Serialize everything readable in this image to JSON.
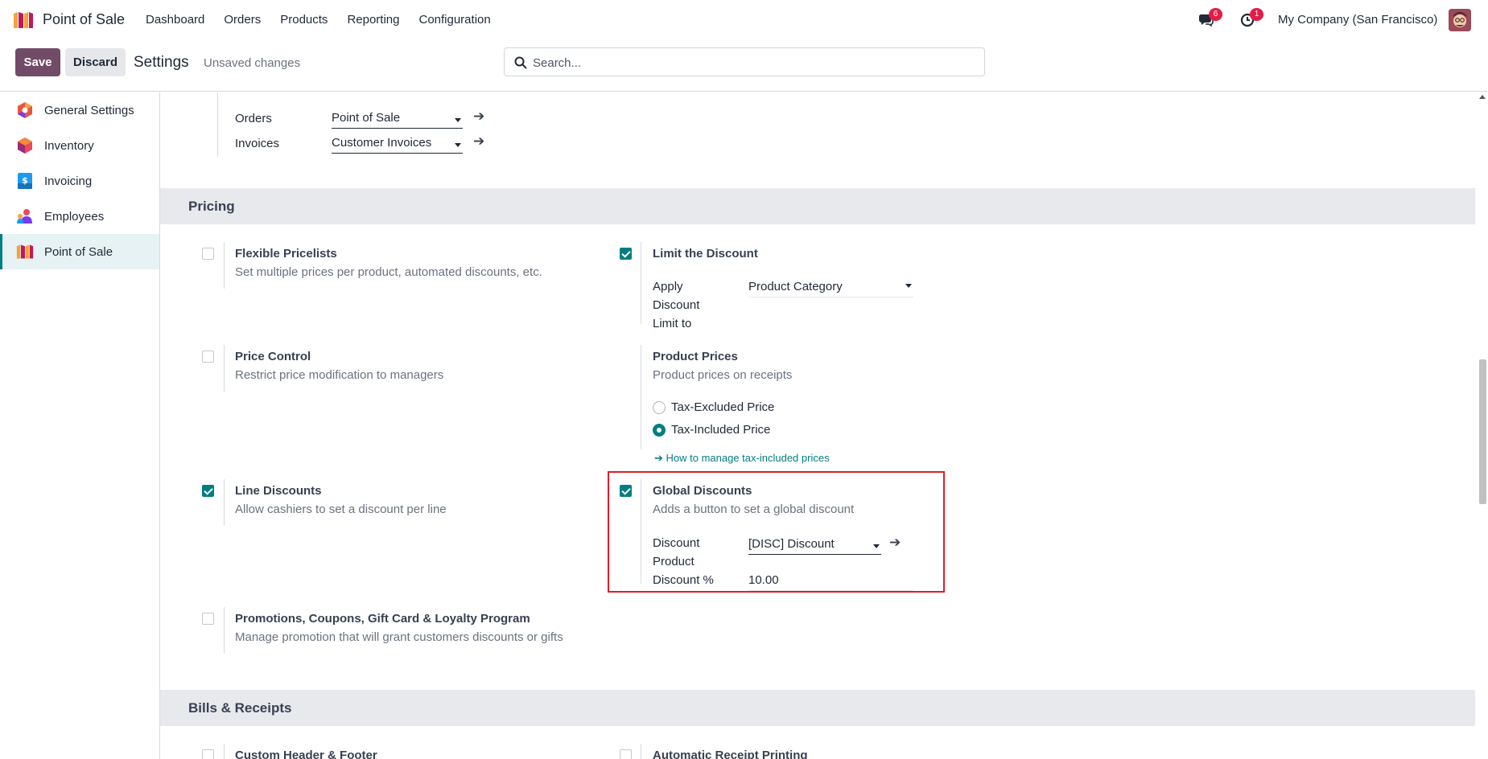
{
  "app": {
    "title": "Point of Sale"
  },
  "menu": [
    "Dashboard",
    "Orders",
    "Products",
    "Reporting",
    "Configuration"
  ],
  "topbar": {
    "messages_count": "6",
    "activities_count": "1",
    "company": "My Company (San Francisco)"
  },
  "control": {
    "save_label": "Save",
    "discard_label": "Discard",
    "breadcrumb": "Settings",
    "status": "Unsaved changes",
    "search_placeholder": "Search..."
  },
  "sidebar": {
    "items": [
      {
        "label": "General Settings",
        "icon": "general-settings-icon"
      },
      {
        "label": "Inventory",
        "icon": "inventory-icon"
      },
      {
        "label": "Invoicing",
        "icon": "invoicing-icon"
      },
      {
        "label": "Employees",
        "icon": "employees-icon"
      },
      {
        "label": "Point of Sale",
        "icon": "pos-icon",
        "active": true
      }
    ]
  },
  "journals": {
    "orders_label": "Orders",
    "orders_value": "Point of Sale",
    "invoices_label": "Invoices",
    "invoices_value": "Customer Invoices"
  },
  "pricing": {
    "section_title": "Pricing",
    "flexible_pricelists": {
      "title": "Flexible Pricelists",
      "desc": "Set multiple prices per product, automated discounts, etc.",
      "checked": false
    },
    "limit_discount": {
      "title": "Limit the Discount",
      "checked": true,
      "apply_label_1": "Apply",
      "apply_label_2": "Discount",
      "apply_label_3": "Limit to",
      "apply_value": "Product Category"
    },
    "price_control": {
      "title": "Price Control",
      "desc": "Restrict price modification to managers",
      "checked": false
    },
    "product_prices": {
      "title": "Product Prices",
      "desc": "Product prices on receipts",
      "option_excluded": "Tax-Excluded Price",
      "option_included": "Tax-Included Price",
      "selected": "Tax-Included Price",
      "help_link": "How to manage tax-included prices"
    },
    "line_discounts": {
      "title": "Line Discounts",
      "desc": "Allow cashiers to set a discount per line",
      "checked": true
    },
    "global_discounts": {
      "title": "Global Discounts",
      "desc": "Adds a button to set a global discount",
      "checked": true,
      "product_label_1": "Discount",
      "product_label_2": "Product",
      "product_value": "[DISC] Discount",
      "percent_label": "Discount %",
      "percent_value": "10.00"
    },
    "promotions": {
      "title": "Promotions, Coupons, Gift Card & Loyalty Program",
      "desc": "Manage promotion that will grant customers discounts or gifts",
      "checked": false
    }
  },
  "bills": {
    "section_title": "Bills & Receipts",
    "custom_header": {
      "title": "Custom Header & Footer",
      "checked": false
    },
    "auto_print": {
      "title": "Automatic Receipt Printing",
      "checked": false
    }
  },
  "colors": {
    "brand": "#714b67",
    "accent": "#017e84",
    "badge": "#e11d48",
    "highlight": "#e11d28"
  }
}
